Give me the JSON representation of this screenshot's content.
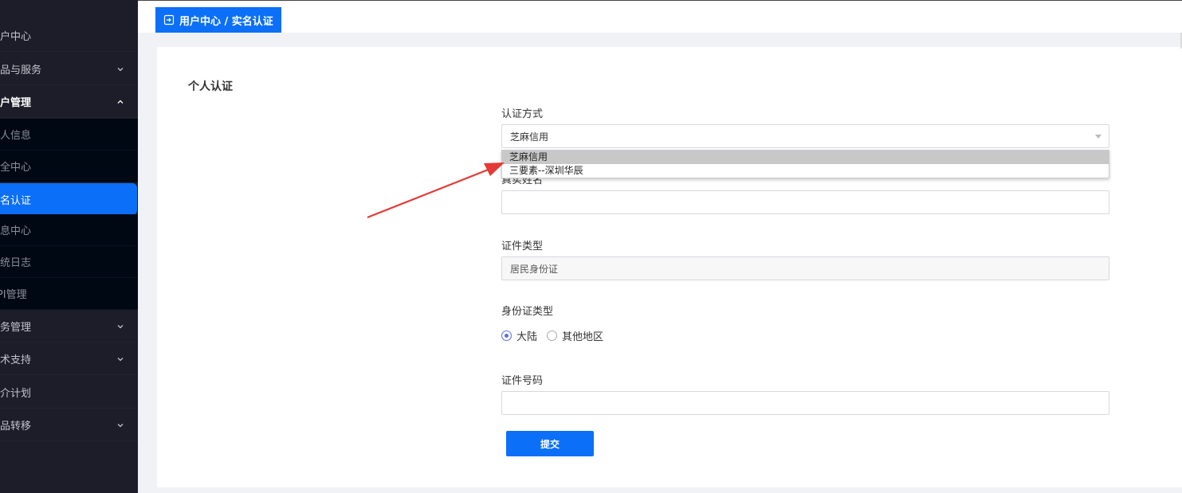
{
  "sidebar": {
    "items": [
      {
        "label": "用户中心",
        "type": "top",
        "expand": ""
      },
      {
        "label": "产品与服务",
        "type": "top",
        "expand": "down"
      },
      {
        "label": "账户管理",
        "type": "top-bold",
        "expand": "up"
      },
      {
        "label": "个人信息",
        "type": "sub"
      },
      {
        "label": "安全中心",
        "type": "sub"
      },
      {
        "label": "实名认证",
        "type": "active"
      },
      {
        "label": "消息中心",
        "type": "sub"
      },
      {
        "label": "系统日志",
        "type": "sub"
      },
      {
        "label": "API管理",
        "type": "sub"
      },
      {
        "label": "财务管理",
        "type": "top",
        "expand": "down"
      },
      {
        "label": "技术支持",
        "type": "top",
        "expand": "down"
      },
      {
        "label": "推介计划",
        "type": "top",
        "expand": ""
      },
      {
        "label": "产品转移",
        "type": "top",
        "expand": "down"
      }
    ]
  },
  "breadcrumb": {
    "text": "用户中心 / 实名认证",
    "icon": "login-icon"
  },
  "form": {
    "section_title": "个人认证",
    "method_label": "认证方式",
    "method_value": "芝麻信用",
    "method_options": [
      "芝麻信用",
      "三要素--深圳华辰"
    ],
    "name_label": "真实姓名",
    "name_value": "",
    "doc_type_label": "证件类型",
    "doc_type_value": "居民身份证",
    "id_type_label": "身份证类型",
    "id_type_options": [
      {
        "label": "大陆",
        "checked": true
      },
      {
        "label": "其他地区",
        "checked": false
      }
    ],
    "id_number_label": "证件号码",
    "id_number_value": "",
    "submit_label": "提交"
  },
  "colors": {
    "primary": "#0b6ff8",
    "sidebar_bg": "#1d1d29",
    "submenu_bg": "#000814",
    "annotation_arrow": "#e53935"
  }
}
